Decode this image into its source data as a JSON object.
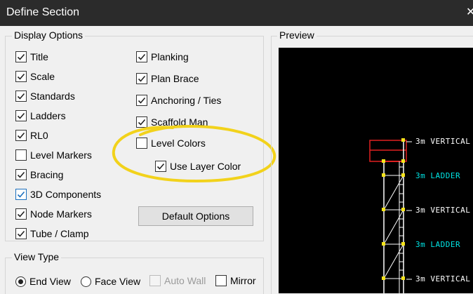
{
  "window": {
    "title": "Define Section",
    "close_glyph": "✕"
  },
  "display_options": {
    "legend": "Display Options",
    "items": [
      {
        "label": "Title",
        "checked": true
      },
      {
        "label": "Scale",
        "checked": true
      },
      {
        "label": "Standards",
        "checked": true
      },
      {
        "label": "Ladders",
        "checked": true
      },
      {
        "label": "RL0",
        "checked": true
      },
      {
        "label": "Level Markers",
        "checked": false
      },
      {
        "label": "Bracing",
        "checked": true
      },
      {
        "label": "3D Components",
        "checked": true
      },
      {
        "label": "Node Markers",
        "checked": true
      },
      {
        "label": "Tube / Clamp",
        "checked": true
      },
      {
        "label": "Planking",
        "checked": true
      },
      {
        "label": "Plan Brace",
        "checked": true
      },
      {
        "label": "Anchoring / Ties",
        "checked": true
      },
      {
        "label": "Scaffold Man",
        "checked": true
      },
      {
        "label": "Level Colors",
        "checked": false
      },
      {
        "label": "Use Layer Color",
        "checked": true
      }
    ],
    "default_button": "Default Options"
  },
  "view_type": {
    "legend": "View Type",
    "options": [
      {
        "label": "End View",
        "selected": true
      },
      {
        "label": "Face View",
        "selected": false
      }
    ],
    "auto_wall": {
      "label": "Auto Wall",
      "checked": false,
      "disabled": true
    },
    "mirror": {
      "label": "Mirror",
      "checked": false
    }
  },
  "preview": {
    "label": "Preview",
    "annotations": [
      {
        "text": "3m VERTICAL",
        "color": "#ffffff"
      },
      {
        "text": "3m LADDER",
        "color": "#00e5e5"
      },
      {
        "text": "3m VERTICAL",
        "color": "#ffffff"
      },
      {
        "text": "3m LADDER",
        "color": "#00e5e5"
      },
      {
        "text": "3m VERTICAL",
        "color": "#ffffff"
      }
    ]
  },
  "colors": {
    "highlight": "#f2d21b",
    "scaffold": "#ffffff",
    "platform": "#e02020",
    "node": "#f5e31a",
    "check_blue": "#1b6fbd"
  }
}
